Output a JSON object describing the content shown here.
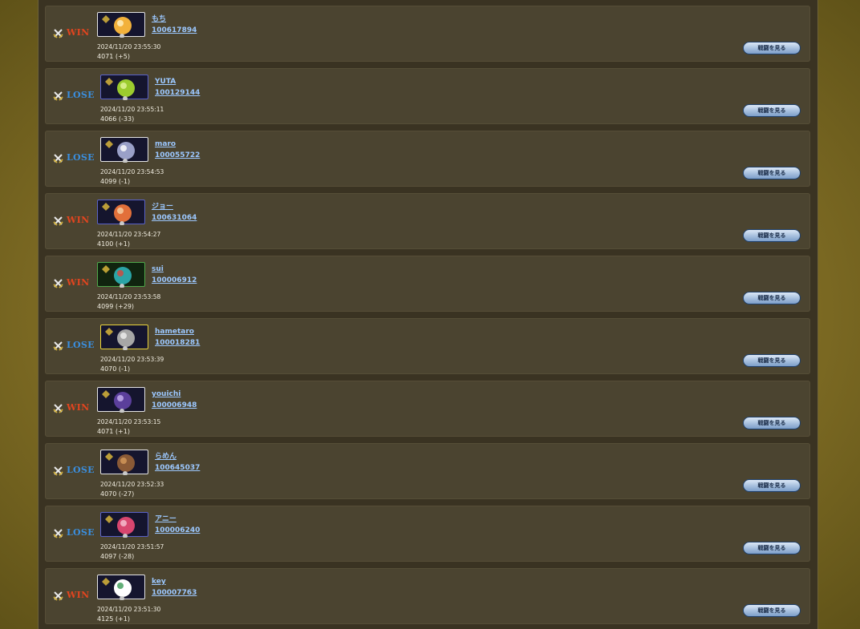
{
  "battle_button_label": "戦闘を見る",
  "colors": {
    "win": "#e2451f",
    "lose": "#3a8fe0",
    "link": "#9cc8ff"
  },
  "matches": [
    {
      "result": "WIN",
      "name": "もち",
      "player_id": "100617894",
      "timestamp": "2024/11/20 23:55:30",
      "rating": "4071 (+5)",
      "frame": "white",
      "icon": "orange-creature-icon"
    },
    {
      "result": "LOSE",
      "name": "YUTA",
      "player_id": "100129144",
      "timestamp": "2024/11/20 23:55:11",
      "rating": "4066 (-33)",
      "frame": "blue",
      "icon": "green-ball-icon"
    },
    {
      "result": "LOSE",
      "name": "maro",
      "player_id": "100055722",
      "timestamp": "2024/11/20 23:54:53",
      "rating": "4099 (-1)",
      "frame": "white",
      "icon": "silver-knight-icon"
    },
    {
      "result": "WIN",
      "name": "ジョー",
      "player_id": "100631064",
      "timestamp": "2024/11/20 23:54:27",
      "rating": "4100 (+1)",
      "frame": "blue",
      "icon": "orange-orb-icon"
    },
    {
      "result": "WIN",
      "name": "sui",
      "player_id": "100006912",
      "timestamp": "2024/11/20 23:53:58",
      "rating": "4099 (+29)",
      "frame": "green",
      "icon": "teal-creature-icon"
    },
    {
      "result": "LOSE",
      "name": "hametaro",
      "player_id": "100018281",
      "timestamp": "2024/11/20 23:53:39",
      "rating": "4070 (-1)",
      "frame": "gold",
      "icon": "grey-beast-icon"
    },
    {
      "result": "WIN",
      "name": "youichi",
      "player_id": "100006948",
      "timestamp": "2024/11/20 23:53:15",
      "rating": "4071 (+1)",
      "frame": "white",
      "icon": "purple-ghost-icon"
    },
    {
      "result": "LOSE",
      "name": "らめん",
      "player_id": "100645037",
      "timestamp": "2024/11/20 23:52:33",
      "rating": "4070 (-27)",
      "frame": "white",
      "icon": "brown-beast-icon"
    },
    {
      "result": "LOSE",
      "name": "アニー",
      "player_id": "100006240",
      "timestamp": "2024/11/20 23:51:57",
      "rating": "4097 (-28)",
      "frame": "blue",
      "icon": "pink-girl-icon"
    },
    {
      "result": "WIN",
      "name": "key",
      "player_id": "100007763",
      "timestamp": "2024/11/20 23:51:30",
      "rating": "4125 (+1)",
      "frame": "white",
      "icon": "sword-emblem-icon"
    }
  ]
}
